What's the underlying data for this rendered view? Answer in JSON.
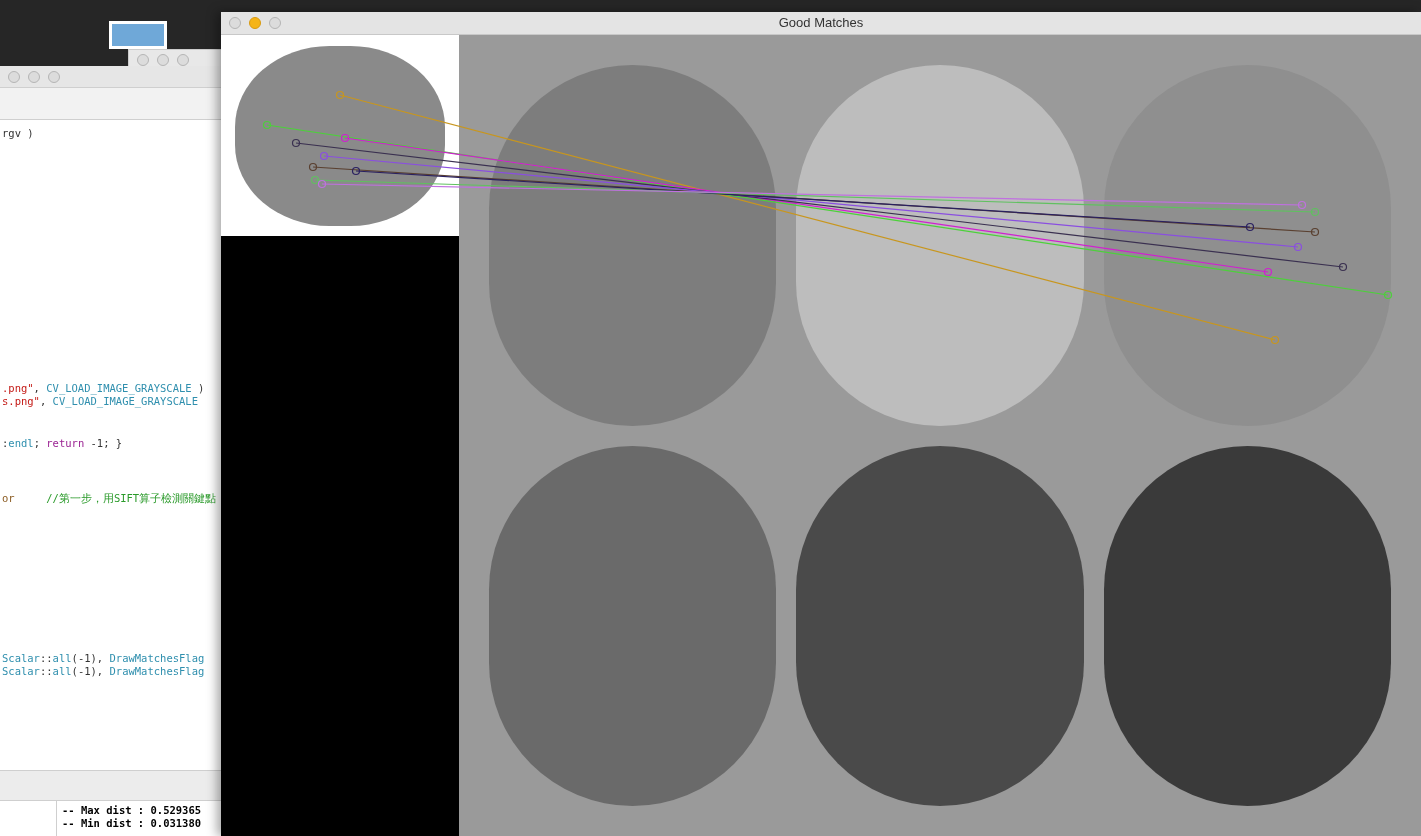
{
  "editor_window": {
    "code_lines": [
      [
        {
          "kind": "plain",
          "text": "rgv )"
        }
      ],
      [
        {
          "kind": "string",
          "text": ".png\""
        },
        {
          "kind": "plain",
          "text": ", "
        },
        {
          "kind": "macro",
          "text": "CV_LOAD_IMAGE_GRAYSCALE"
        },
        {
          "kind": "plain",
          "text": " )"
        }
      ],
      [
        {
          "kind": "string",
          "text": "s.png\""
        },
        {
          "kind": "plain",
          "text": ", "
        },
        {
          "kind": "macro",
          "text": "CV_LOAD_IMAGE_GRAYSCALE"
        }
      ],
      [
        {
          "kind": "plain",
          "text": ":"
        },
        {
          "kind": "macro",
          "text": "endl"
        },
        {
          "kind": "plain",
          "text": "; "
        },
        {
          "kind": "keyword",
          "text": "return"
        },
        {
          "kind": "plain",
          "text": " -1; }"
        }
      ],
      [
        {
          "kind": "type",
          "text": "or     "
        },
        {
          "kind": "comment",
          "text": "//第一步，用SIFT算子檢測關鍵點"
        }
      ],
      [
        {
          "kind": "macro",
          "text": "Scalar"
        },
        {
          "kind": "plain",
          "text": "::"
        },
        {
          "kind": "macro",
          "text": "all"
        },
        {
          "kind": "plain",
          "text": "(-1), "
        },
        {
          "kind": "macro",
          "text": "DrawMatchesFlag"
        }
      ],
      [
        {
          "kind": "macro",
          "text": "Scalar"
        },
        {
          "kind": "plain",
          "text": "::"
        },
        {
          "kind": "macro",
          "text": "all"
        },
        {
          "kind": "plain",
          "text": "(-1), "
        },
        {
          "kind": "macro",
          "text": "DrawMatchesFlag"
        }
      ]
    ],
    "console_lines": [
      "-- Max dist : 0.529365",
      "-- Min dist : 0.031380"
    ]
  },
  "image_window": {
    "title": "Good Matches"
  }
}
